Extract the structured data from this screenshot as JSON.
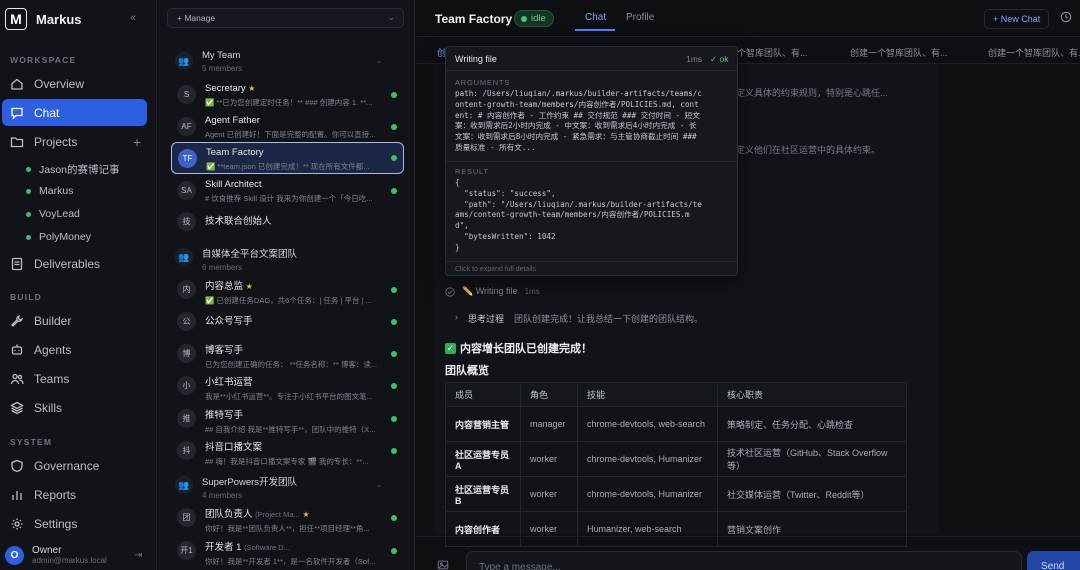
{
  "sidebar": {
    "brand": "Markus",
    "logo_letter": "M",
    "collapse": "«",
    "sections": {
      "workspace": "WORKSPACE",
      "build": "BUILD",
      "system": "SYSTEM"
    },
    "nav": {
      "overview": "Overview",
      "chat": "Chat",
      "projects": "Projects",
      "deliverables": "Deliverables",
      "builder": "Builder",
      "agents": "Agents",
      "teams": "Teams",
      "skills": "Skills",
      "governance": "Governance",
      "reports": "Reports",
      "settings": "Settings"
    },
    "projects_add": "+",
    "projects": [
      "Jason的赛博记事",
      "Markus",
      "VoyLead",
      "PolyMoney"
    ],
    "owner": {
      "initial": "O",
      "name": "Owner",
      "email": "admin@markus.local",
      "logout": "⇥"
    }
  },
  "middle": {
    "manage": "+ Manage",
    "groups": [
      {
        "title": "My Team",
        "sub": "5 members"
      },
      {
        "title": "自媒体全平台文案团队",
        "sub": "6 members"
      },
      {
        "title": "SuperPowers开发团队",
        "sub": "4 members"
      }
    ],
    "agents": [
      {
        "av": "S",
        "name": "Secretary",
        "star": "★",
        "sub": "✅ **已为您创建定时任务！** ### 创建内容 1. **..."
      },
      {
        "av": "AF",
        "name": "Agent Father",
        "sub": "Agent 已创建好！下面是完整的配置。你可以直接..."
      },
      {
        "av": "TF",
        "name": "Team Factory",
        "sub": "✅ **team.json 已创建完成！** 现在所有文件都..."
      },
      {
        "av": "SA",
        "name": "Skill Architect",
        "sub": "# 饮食推荐 Skill 设计 我来为你创建一个「今日吃..."
      },
      {
        "av": "技",
        "name": "技术联合创始人",
        "sub": ""
      },
      {
        "av": "内",
        "name": "内容总监",
        "star": "★",
        "sub": "✅ 已创建任务DAG，共6个任务：| 任务 | 平台 | ..."
      },
      {
        "av": "公",
        "name": "公众号写手",
        "sub": ""
      },
      {
        "av": "博",
        "name": "博客写手",
        "sub": "已为您创建正确的任务： **任务名称：** 博客：读..."
      },
      {
        "av": "小",
        "name": "小红书运营",
        "sub": "我是**小红书运营**。专注于小红书平台的图文笔..."
      },
      {
        "av": "推",
        "name": "推特写手",
        "sub": "## 自我介绍 我是**推特写手**，团队中的推特（X..."
      },
      {
        "av": "抖",
        "name": "抖音口播文案",
        "sub": "## 嗨！我是抖音口播文案专家 🎬 我的专长：**..."
      },
      {
        "av": "团",
        "name": "团队负责人",
        "role": "(Project Ma...",
        "star": "★",
        "sub": "你好！我是**团队负责人**，担任**项目经理**角..."
      },
      {
        "av": "开1",
        "name": "开发者 1",
        "role": "(Software D...",
        "sub": "你好！我是**开发者 1**，是一名软件开发者（Sof..."
      }
    ]
  },
  "main": {
    "title": "Team Factory",
    "status": "idle",
    "tabs": [
      "Chat",
      "Profile"
    ],
    "new_chat": "+ New Chat",
    "subtabs": [
      "创",
      "个智库团队、有...",
      "创建一个智库团队、有...",
      "创建一个智库团队、有..."
    ],
    "faded_lines": [
      "定义具体的约束规则，特别是心跳任...",
      "定义他们在社区运营中的具体约束。"
    ],
    "step": {
      "label": "✏️ Writing file",
      "ms": "1ms"
    },
    "thinking": {
      "label": "思考过程",
      "text": "团队创建完成！让我总结一下创建的团队结构。"
    },
    "done_title": "内容增长团队已创建完成！",
    "overview_title": "团队概览",
    "table": {
      "headers": [
        "成员",
        "角色",
        "技能",
        "核心职责"
      ],
      "rows": [
        [
          "内容营销主管",
          "manager",
          "chrome-devtools, web-search",
          "策略制定、任务分配、心跳检查"
        ],
        [
          "社区运营专员A",
          "worker",
          "chrome-devtools, Humanizer",
          "技术社区运营（GitHub、Stack Overflow等）"
        ],
        [
          "社区运营专员B",
          "worker",
          "chrome-devtools, Humanizer",
          "社交媒体运营（Twitter、Reddit等）"
        ],
        [
          "内容创作者",
          "worker",
          "Humanizer, web-search",
          "营销文案创作"
        ]
      ]
    },
    "input_placeholder": "Type a message...",
    "send": "Send"
  },
  "popover": {
    "title": "Writing file",
    "ms": "1ms",
    "ok": "✓ ok",
    "arguments_label": "ARGUMENTS",
    "arguments": "path: /Users/liuqian/.markus/builder-artifacts/teams/c\nontent-growth-team/members/内容创作者/POLICIES.md, cont\nent: # 内容创作者 - 工作约束 ## 交付规范 ### 交付时间 - 短文\n案：收到需求后2小时内完成 - 中文案：收到需求后4小时内完成 - 长\n文案：收到需求后8小时内完成 - 紧急需求：与主管协商截止时间 ###\n质量标准 - 所有文...",
    "result_label": "RESULT",
    "result": "{\n  \"status\": \"success\",\n  \"path\": \"/Users/liuqian/.markus/builder-artifacts/te\nams/content-growth-team/members/内容创作者/POLICIES.m\nd\",\n  \"bytesWritten\": 1042\n}",
    "footer": "Click to expand full details"
  }
}
